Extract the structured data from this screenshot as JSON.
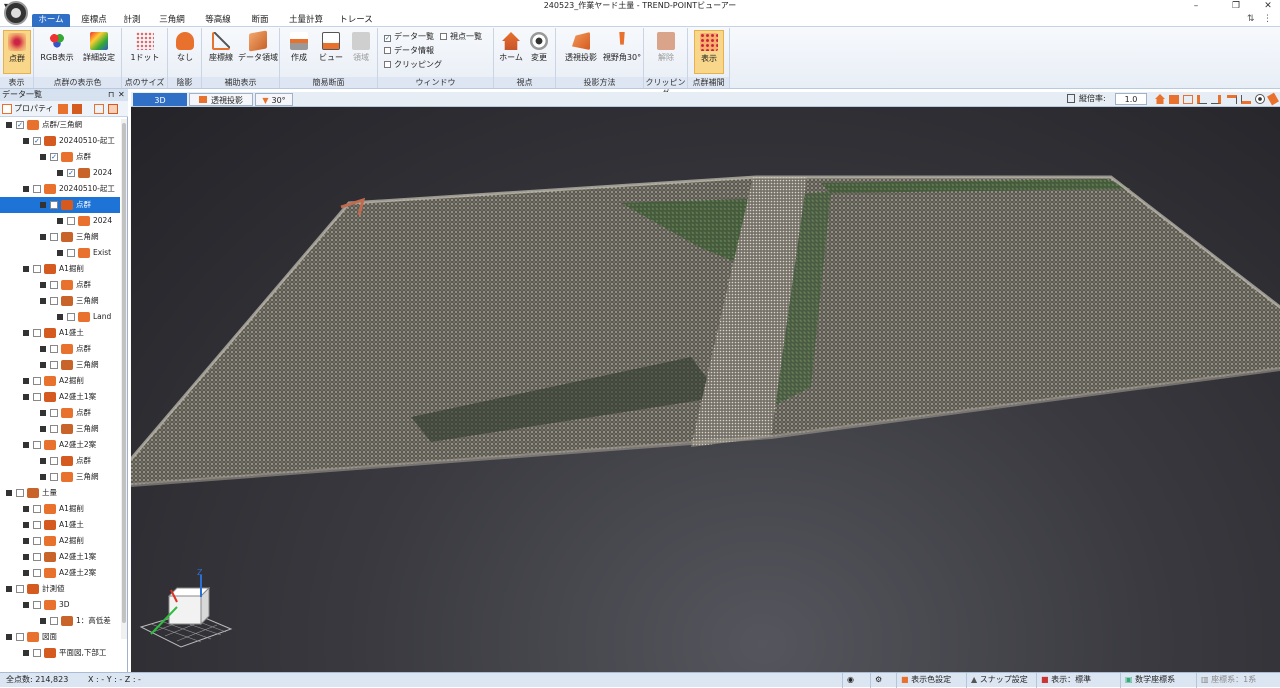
{
  "window": {
    "title": "240523_作業ヤード土量 - TREND-POINTビューアー"
  },
  "tabs": [
    "ホーム",
    "座標点",
    "計測",
    "三角網",
    "等高線",
    "断面",
    "土量計算",
    "トレース"
  ],
  "ribbon": {
    "groups": {
      "display": "表示",
      "point_color": "点群の表示色",
      "point_size": "点のサイズ",
      "shadow": "陰影",
      "aux": "補助表示",
      "section": "簡易断面",
      "window": "ウィンドウ",
      "viewpoint": "視点",
      "projection": "投影方法",
      "clipping": "クリッピング",
      "interp": "点群補間"
    },
    "buttons": {
      "point_cloud": "点群",
      "rgb": "RGB表示",
      "detail": "詳細設定",
      "dot": "1ドット",
      "none": "なし",
      "coord_line": "座標線",
      "data_area": "データ領域",
      "create": "作成",
      "view": "ビュー",
      "area": "領域",
      "home": "ホーム",
      "change": "変更",
      "perspective": "透視投影",
      "fov": "視野角30°",
      "release": "解除",
      "show": "表示"
    },
    "checks": {
      "data_list": "データ一覧",
      "viewpoint_list": "視点一覧",
      "data_info": "データ情報",
      "clipping": "クリッピング"
    }
  },
  "panel": {
    "title": "データ一覧",
    "properties": "プロパティ",
    "tree": [
      {
        "label": "点群/三角網",
        "checked": true
      },
      {
        "label": "20240510-起工",
        "checked": true
      },
      {
        "label": "点群",
        "checked": true
      },
      {
        "label": "2024",
        "checked": true
      },
      {
        "label": "20240510-起工",
        "checked": false
      },
      {
        "label": "点群",
        "checked": false
      },
      {
        "label": "2024",
        "checked": false
      },
      {
        "label": "三角網",
        "checked": false
      },
      {
        "label": "Exist",
        "checked": false
      },
      {
        "label": "A1掘削",
        "checked": false
      },
      {
        "label": "点群",
        "checked": false
      },
      {
        "label": "三角網",
        "checked": false
      },
      {
        "label": "Land",
        "checked": false
      },
      {
        "label": "A1盛土",
        "checked": false
      },
      {
        "label": "点群",
        "checked": false
      },
      {
        "label": "三角網",
        "checked": false
      },
      {
        "label": "A2掘削",
        "checked": false
      },
      {
        "label": "A2盛土1案",
        "checked": false
      },
      {
        "label": "点群",
        "checked": false
      },
      {
        "label": "三角網",
        "checked": false
      },
      {
        "label": "A2盛土2案",
        "checked": false
      },
      {
        "label": "点群",
        "checked": false
      },
      {
        "label": "三角網",
        "checked": false
      },
      {
        "label": "土量",
        "checked": false
      },
      {
        "label": "A1掘削",
        "checked": false
      },
      {
        "label": "A1盛土",
        "checked": false
      },
      {
        "label": "A2掘削",
        "checked": false
      },
      {
        "label": "A2盛土1案",
        "checked": false
      },
      {
        "label": "A2盛土2案",
        "checked": false
      },
      {
        "label": "計測値",
        "checked": false
      },
      {
        "label": "3D",
        "checked": false
      },
      {
        "label": "1：高低差",
        "checked": false
      },
      {
        "label": "図面",
        "checked": false
      },
      {
        "label": "平面図,下部工",
        "checked": false
      }
    ]
  },
  "viewtabs": {
    "mode": "3D",
    "projection": "透視投影",
    "angle": "30°"
  },
  "viewtoolbar": {
    "scale_label": "縦倍率:",
    "scale_value": "1.0"
  },
  "axis": {
    "z": "Z",
    "x": "X",
    "y": "Y"
  },
  "status": {
    "points": "全点数: 214,823",
    "coords": "X : - Y : - Z : -",
    "color_setting": "表示色設定",
    "snap_setting": "スナップ設定",
    "display": "表示：標準",
    "coord_system": "数学座標系",
    "coord_sys_no": "座標系：1系"
  }
}
